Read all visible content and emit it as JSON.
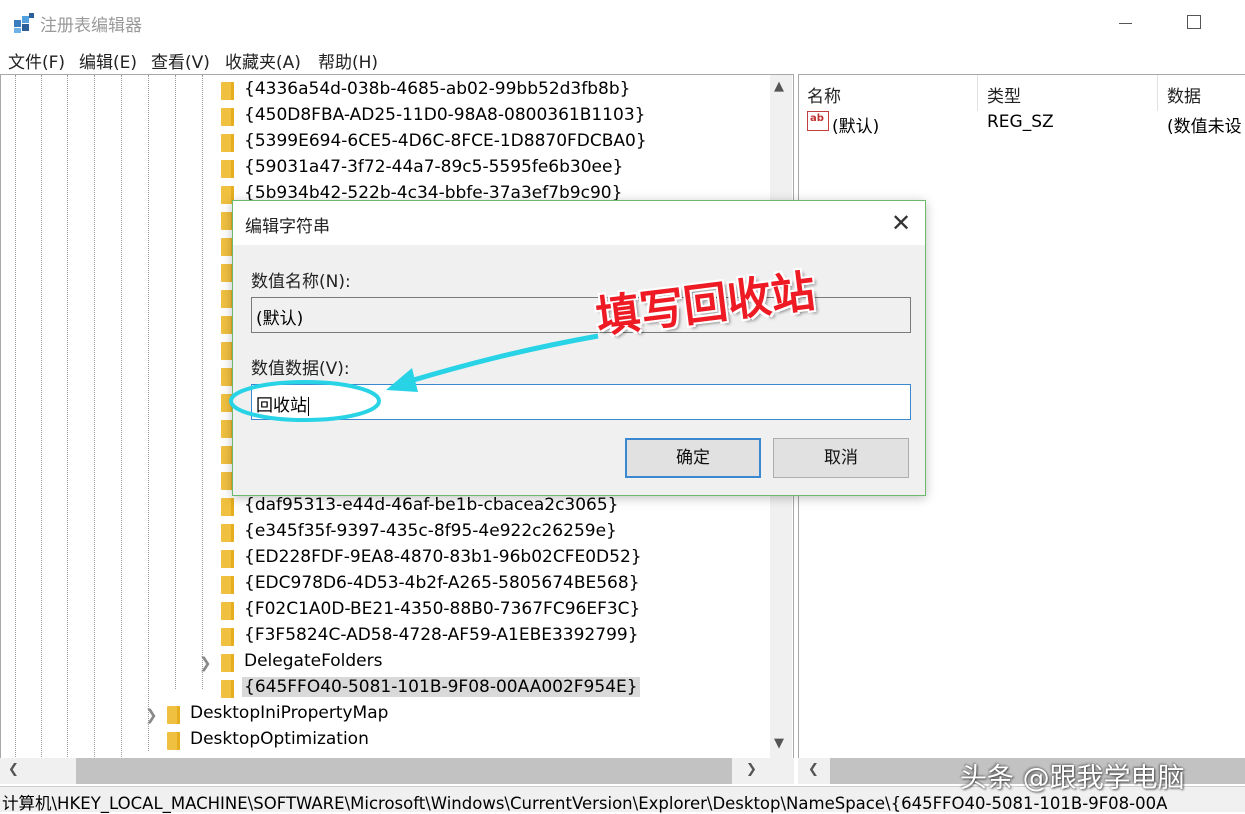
{
  "window": {
    "title": "注册表编辑器"
  },
  "menu": [
    "文件(F)",
    "编辑(E)",
    "查看(V)",
    "收藏夹(A)",
    "帮助(H)"
  ],
  "tree": {
    "items": [
      "{4336a54d-038b-4685-ab02-99bb52d3fb8b}",
      "{450D8FBA-AD25-11D0-98A8-0800361B1103}",
      "{5399E694-6CE5-4D6C-8FCE-1D8870FDCBA0}",
      "{59031a47-3f72-44a7-89c5-5595fe6b30ee}",
      "{5b934b42-522b-4c34-bbfe-37a3ef7b9c90}",
      "{daf95313-e44d-46af-be1b-cbacea2c3065}",
      "{e345f35f-9397-435c-8f95-4e922c26259e}",
      "{ED228FDF-9EA8-4870-83b1-96b02CFE0D52}",
      "{EDC978D6-4D53-4b2f-A265-5805674BE568}",
      "{F02C1A0D-BE21-4350-88B0-7367FC96EF3C}",
      "{F3F5824C-AD58-4728-AF59-A1EBE3392799}",
      "DelegateFolders",
      "{645FFO40-5081-101B-9F08-00AA002F954E}",
      "DesktopIniPropertyMap",
      "DesktopOptimization"
    ]
  },
  "values_pane": {
    "columns": [
      "名称",
      "类型",
      "数据"
    ],
    "row": {
      "name": "(默认)",
      "type": "REG_SZ",
      "data": "(数值未设"
    }
  },
  "status_path": "计算机\\HKEY_LOCAL_MACHINE\\SOFTWARE\\Microsoft\\Windows\\CurrentVersion\\Explorer\\Desktop\\NameSpace\\{645FFO40-5081-101B-9F08-00A",
  "dialog": {
    "title": "编辑字符串",
    "name_label": "数值名称(N):",
    "name_value": "(默认)",
    "data_label": "数值数据(V):",
    "data_value": "回收站",
    "ok_label": "确定",
    "cancel_label": "取消"
  },
  "annotation": {
    "text": "填写回收站",
    "color": "#ee1b24",
    "arrow_color": "#29d3e6"
  },
  "watermark": "头条 @跟我学电脑"
}
